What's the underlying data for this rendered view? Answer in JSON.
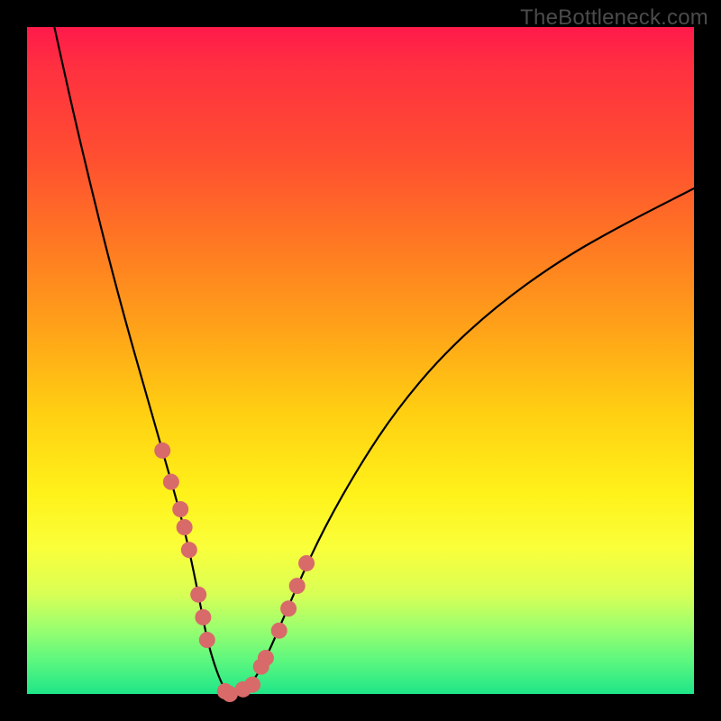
{
  "watermark": "TheBottleneck.com",
  "colors": {
    "frame_bg": "#000000",
    "gradient_top": "#ff1a4b",
    "gradient_bottom": "#1fe688",
    "curve_stroke": "#000000",
    "marker_fill": "#d86a6a",
    "watermark_color": "#4b4b4b"
  },
  "chart_data": {
    "type": "line",
    "title": "",
    "xlabel": "",
    "ylabel": "",
    "xlim": [
      0,
      100
    ],
    "ylim": [
      0,
      100
    ],
    "grid": false,
    "legend": false,
    "note": "Single V-shaped curve over a vertical red→green gradient. No axis ticks or labels are rendered. Values below are estimated from pixel positions; y is 0 at bottom, 100 at top.",
    "x": [
      4.1,
      6.8,
      9.5,
      12.2,
      14.9,
      17.6,
      20.3,
      23.0,
      24.3,
      25.7,
      27.0,
      28.4,
      29.7,
      31.1,
      33.8,
      36.5,
      40.5,
      44.6,
      50.0,
      55.4,
      62.2,
      70.3,
      79.7,
      89.2,
      100.0
    ],
    "y": [
      100.0,
      87.8,
      76.4,
      65.5,
      55.4,
      45.9,
      36.5,
      27.0,
      21.6,
      14.9,
      8.1,
      3.4,
      0.5,
      0.0,
      1.4,
      6.8,
      16.2,
      25.0,
      34.5,
      42.6,
      50.7,
      58.1,
      64.9,
      70.3,
      75.8
    ],
    "series": [
      {
        "name": "curve",
        "x": [
          4.1,
          6.8,
          9.5,
          12.2,
          14.9,
          17.6,
          20.3,
          23.0,
          24.3,
          25.7,
          27.0,
          28.4,
          29.7,
          31.1,
          33.8,
          36.5,
          40.5,
          44.6,
          50.0,
          55.4,
          62.2,
          70.3,
          79.7,
          89.2,
          100.0
        ],
        "y": [
          100.0,
          87.8,
          76.4,
          65.5,
          55.4,
          45.9,
          36.5,
          27.0,
          21.6,
          14.9,
          8.1,
          3.4,
          0.5,
          0.0,
          1.4,
          6.8,
          16.2,
          25.0,
          34.5,
          42.6,
          50.7,
          58.1,
          64.9,
          70.3,
          75.8
        ]
      }
    ],
    "markers": {
      "note": "Salmon-colored circular markers clustered near the bottom of the V on both arms.",
      "x": [
        20.3,
        21.6,
        23.0,
        23.6,
        24.3,
        25.7,
        26.4,
        27.0,
        29.7,
        30.4,
        32.4,
        33.8,
        35.1,
        35.8,
        37.8,
        39.2,
        40.5,
        41.9
      ],
      "y": [
        36.5,
        31.8,
        27.7,
        25.0,
        21.6,
        14.9,
        11.5,
        8.1,
        0.4,
        0.0,
        0.7,
        1.4,
        4.1,
        5.4,
        9.5,
        12.8,
        16.2,
        19.6
      ],
      "radius": 9
    }
  }
}
